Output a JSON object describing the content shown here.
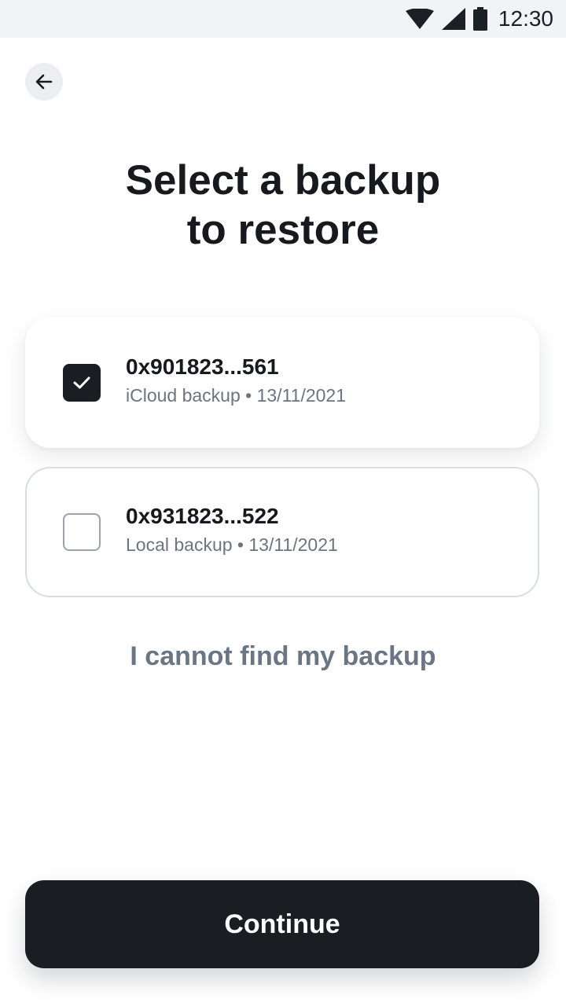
{
  "status_bar": {
    "time": "12:30",
    "icons": [
      "wifi-icon",
      "cell-signal-icon",
      "battery-icon"
    ]
  },
  "header": {
    "back_icon": "arrow-left-icon"
  },
  "title": {
    "line1": "Select a backup",
    "line2": "to restore"
  },
  "backups": [
    {
      "address": "0x901823...561",
      "source": "iCloud backup",
      "separator": " • ",
      "date": "13/11/2021",
      "subtitle": "iCloud backup • 13/11/2021",
      "selected": true
    },
    {
      "address": "0x931823...522",
      "source": "Local backup",
      "separator": " • ",
      "date": "13/11/2021",
      "subtitle": "Local backup • 13/11/2021",
      "selected": false
    }
  ],
  "help_link": "I cannot find my backup",
  "continue_label": "Continue",
  "colors": {
    "primary": "#1a1d21",
    "muted_text": "#6b7685",
    "status_bar_bg": "#f1f3f6",
    "card_border": "#d9dce1"
  }
}
